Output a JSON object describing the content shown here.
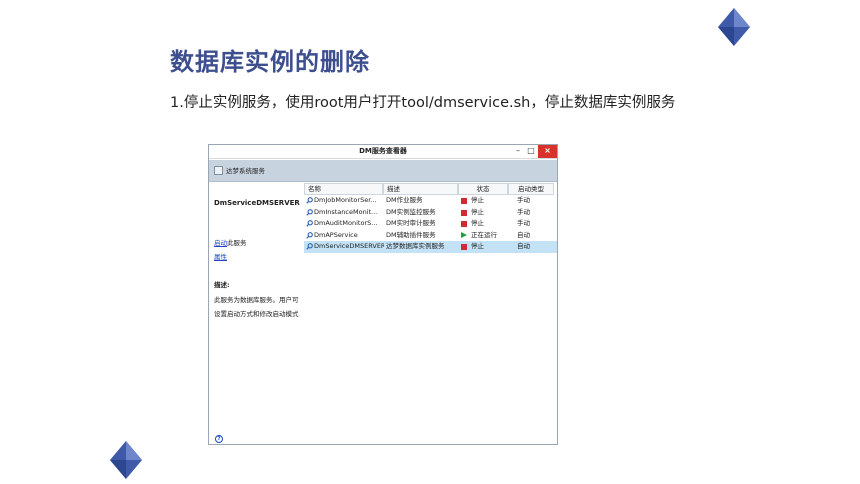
{
  "slide": {
    "title": "数据库实例的删除",
    "step_text": "1.停止实例服务，使用root用户打开tool/dmservice.sh，停止数据库实例服务"
  },
  "window": {
    "title": "DM服务查看器",
    "minimize_label": "–",
    "maximize_label": "□",
    "close_label": "×",
    "header_label": "达梦系统服务",
    "selected_service": "DmServiceDMSERVER",
    "start_link": "启动",
    "start_suffix": "此服务",
    "properties_link": "属性",
    "description_label": "描述:",
    "description_text": "此服务为数据库服务。用户可设置启动方式和修改启动模式",
    "help_label": "?",
    "columns": [
      "名称",
      "描述",
      "状态",
      "启动类型"
    ],
    "services": [
      {
        "name": "DmJobMonitorSer...",
        "desc": "DM作业服务",
        "state": "停止",
        "status_icon": "stopped-icon",
        "type": "手动"
      },
      {
        "name": "DmInstanceMonit...",
        "desc": "DM实例监控服务",
        "state": "停止",
        "status_icon": "stopped-icon",
        "type": "手动"
      },
      {
        "name": "DmAuditMonitorS...",
        "desc": "DM实时审计服务",
        "state": "停止",
        "status_icon": "stopped-icon",
        "type": "手动"
      },
      {
        "name": "DmAPService",
        "desc": "DM辅助插件服务",
        "state": "正在运行",
        "status_icon": "running-icon",
        "type": "自动"
      },
      {
        "name": "DmServiceDMSERVER",
        "desc": "达梦数据库实例服务",
        "state": "停止",
        "status_icon": "stopped-icon",
        "type": "自动"
      }
    ]
  },
  "colors": {
    "title": "#3d4f8e",
    "selection": "#c3e2f5",
    "stopped": "#d22a32",
    "running": "#1d9f35",
    "link": "#1a47c8"
  }
}
